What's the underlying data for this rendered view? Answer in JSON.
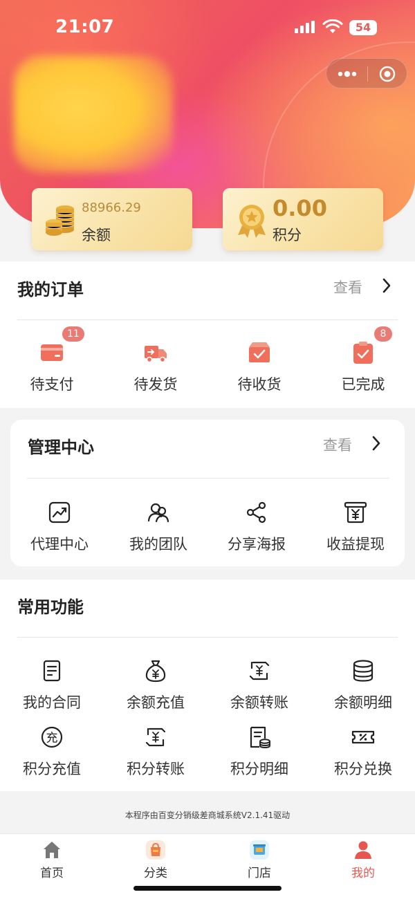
{
  "status_bar": {
    "time": "21:07",
    "battery": "54"
  },
  "header": {
    "balance": {
      "value": "88966.29",
      "label": "余额"
    },
    "points": {
      "value": "0.00",
      "label": "积分"
    }
  },
  "orders": {
    "title": "我的订单",
    "more": "查看",
    "items": [
      {
        "label": "待支付",
        "icon": "card-icon",
        "badge": "11"
      },
      {
        "label": "待发货",
        "icon": "truck-icon",
        "badge": ""
      },
      {
        "label": "待收货",
        "icon": "box-check-icon",
        "badge": ""
      },
      {
        "label": "已完成",
        "icon": "clipboard-check-icon",
        "badge": "8"
      }
    ]
  },
  "management": {
    "title": "管理中心",
    "more": "查看",
    "items": [
      {
        "label": "代理中心",
        "icon": "trend-chart-icon"
      },
      {
        "label": "我的团队",
        "icon": "team-icon"
      },
      {
        "label": "分享海报",
        "icon": "share-icon"
      },
      {
        "label": "收益提现",
        "icon": "withdraw-icon"
      }
    ]
  },
  "functions": {
    "title": "常用功能",
    "items": [
      {
        "label": "我的合同",
        "icon": "contract-icon"
      },
      {
        "label": "余额充值",
        "icon": "money-bag-icon"
      },
      {
        "label": "余额转账",
        "icon": "transfer-icon"
      },
      {
        "label": "余额明细",
        "icon": "coins-stack-icon"
      },
      {
        "label": "积分充值",
        "icon": "recharge-icon"
      },
      {
        "label": "积分转账",
        "icon": "transfer-icon"
      },
      {
        "label": "积分明细",
        "icon": "bill-detail-icon"
      },
      {
        "label": "积分兑换",
        "icon": "coupon-icon"
      }
    ]
  },
  "footer": {
    "text": "本程序由百变分销级差商城系统V2.1.41驱动"
  },
  "tabbar": {
    "items": [
      {
        "label": "首页",
        "icon": "home-icon",
        "active": false
      },
      {
        "label": "分类",
        "icon": "category-icon",
        "active": false
      },
      {
        "label": "门店",
        "icon": "store-icon",
        "active": false
      },
      {
        "label": "我的",
        "icon": "profile-icon",
        "active": true
      }
    ]
  },
  "colors": {
    "accent": "#e8574f",
    "gold": "#c48a2c",
    "badge": "#ea7a74"
  }
}
